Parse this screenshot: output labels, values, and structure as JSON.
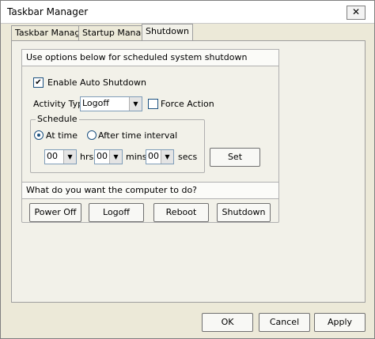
{
  "window": {
    "title": "Taskbar Manager",
    "close_glyph": "✕"
  },
  "tabs": [
    {
      "label": "Taskbar Manager"
    },
    {
      "label": "Startup Manager"
    },
    {
      "label": "Shutdown"
    }
  ],
  "shutdown": {
    "header": "Use options below for scheduled system shutdown",
    "enable_label": "Enable Auto Shutdown",
    "enable_checked": true,
    "activity_label": "Activity Type",
    "activity_value": "Logoff",
    "force_label": "Force Action",
    "force_checked": false,
    "schedule_legend": "Schedule",
    "at_time_label": "At time",
    "interval_label": "After time interval",
    "hrs_value": "00",
    "hrs_label": "hrs",
    "mins_value": "00",
    "mins_label": "mins",
    "secs_value": "00",
    "secs_label": "secs",
    "set_button": "Set"
  },
  "actions": {
    "header": "What do you want the computer to do?",
    "buttons": [
      "Power Off",
      "Logoff",
      "Reboot",
      "Shutdown"
    ]
  },
  "footer": {
    "ok": "OK",
    "cancel": "Cancel",
    "apply": "Apply"
  },
  "icons": {
    "check": "✔",
    "dropdown": "▼"
  }
}
